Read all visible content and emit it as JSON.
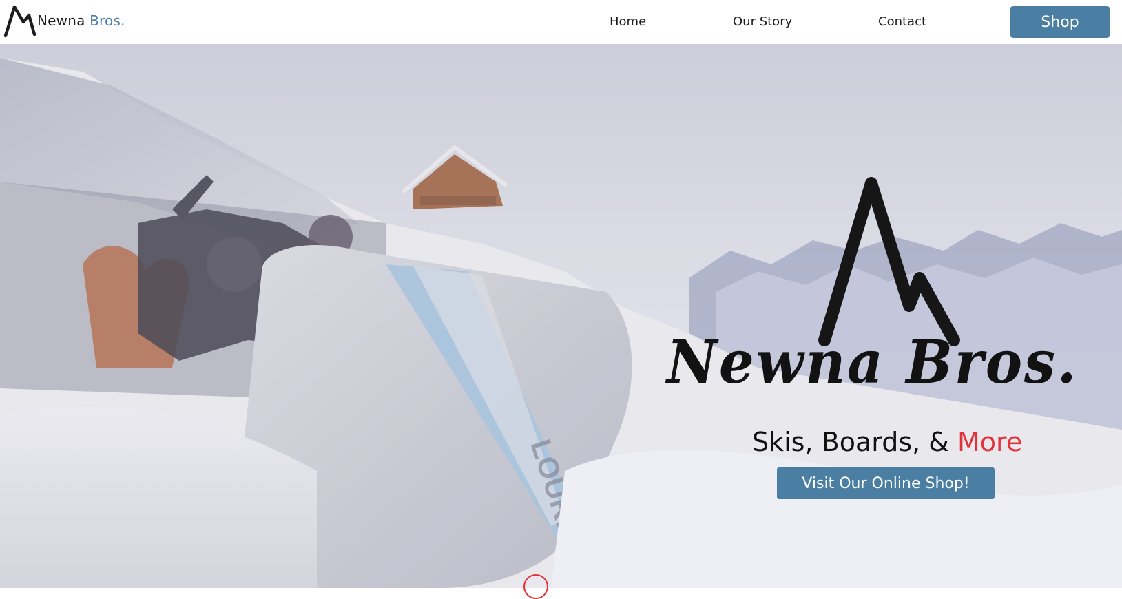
{
  "navbar": {
    "brand_name": "Newna",
    "brand_accent": "Bros.",
    "links": [
      {
        "label": "Home"
      },
      {
        "label": "Our Story"
      },
      {
        "label": "Contact"
      }
    ],
    "shop_label": "Shop",
    "logo_icon": "mountain-icon"
  },
  "hero": {
    "wordmark": "Newna Bros.",
    "tagline_main": "Skis, Boards, & ",
    "tagline_accent": "More",
    "cta_label": "Visit Our Online Shop!",
    "logo_icon": "mountain-icon",
    "background_image": "snowboard-in-snow-image",
    "scroll_icon": "scroll-down-icon"
  },
  "colors": {
    "accent_blue": "#4a7fa3",
    "accent_red": "#e3323a",
    "text_dark": "#1d1d1d"
  }
}
